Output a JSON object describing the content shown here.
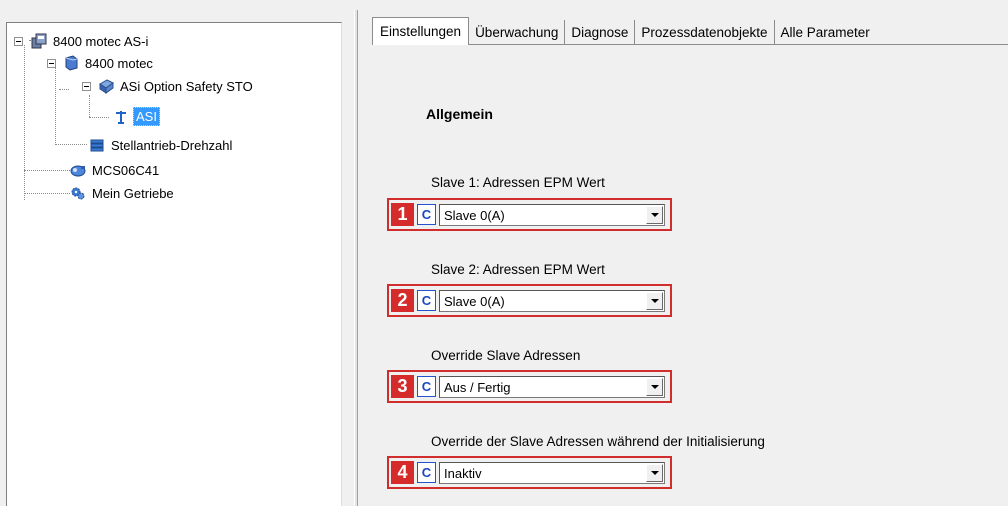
{
  "tree": {
    "nodes": [
      {
        "label": "8400 motec AS-i",
        "icon": "device-group-icon"
      },
      {
        "label": "8400 motec",
        "icon": "inverter-icon"
      },
      {
        "label": "ASi Option Safety STO",
        "icon": "safety-module-icon"
      },
      {
        "label": "ASI",
        "icon": "antenna-icon"
      },
      {
        "label": "Stellantrieb-Drehzahl",
        "icon": "application-icon"
      },
      {
        "label": "MCS06C41",
        "icon": "motor-icon"
      },
      {
        "label": "Mein Getriebe",
        "icon": "gearbox-icon"
      }
    ],
    "selected": "ASI"
  },
  "tabs": [
    "Einstellungen",
    "Überwachung",
    "Diagnose",
    "Prozessdatenobjekte",
    "Alle Parameter"
  ],
  "active_tab": "Einstellungen",
  "section": {
    "heading": "Allgemein"
  },
  "params": [
    {
      "number": "1",
      "badge": "C",
      "label": "Slave 1: Adressen EPM Wert",
      "value": "Slave  0(A)"
    },
    {
      "number": "2",
      "badge": "C",
      "label": "Slave 2: Adressen EPM Wert",
      "value": "Slave  0(A)"
    },
    {
      "number": "3",
      "badge": "C",
      "label": "Override Slave Adressen",
      "value": "Aus / Fertig"
    },
    {
      "number": "4",
      "badge": "C",
      "label": "Override der Slave Adressen während der Initialisierung",
      "value": "Inaktiv"
    }
  ],
  "colors": {
    "highlight": "#d22d2d",
    "selection": "#3399ff",
    "c_badge": "#1a47c2"
  }
}
